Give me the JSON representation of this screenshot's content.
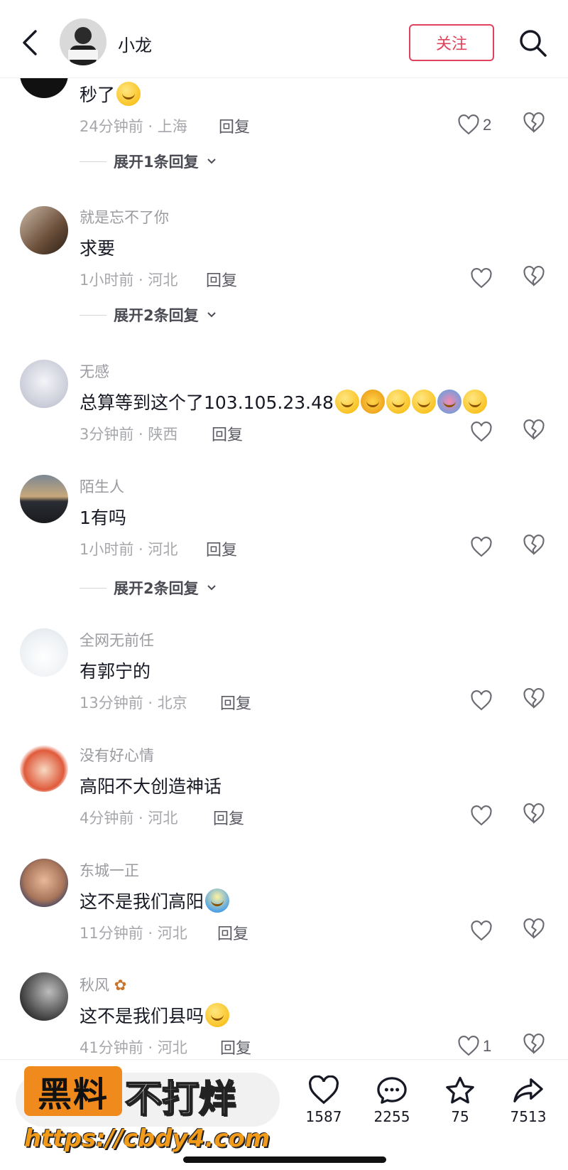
{
  "header": {
    "title": "小龙",
    "follow_label": "关注"
  },
  "comments": [
    {
      "name": "",
      "text": "秒了",
      "time": "24分钟前 · 上海",
      "reply": "回复",
      "likes": "2",
      "expand": "展开1条回复"
    },
    {
      "name": "就是忘不了你",
      "text": "求要",
      "time": "1小时前 · 河北",
      "reply": "回复",
      "likes": "",
      "expand": "展开2条回复"
    },
    {
      "name": "无感",
      "text": "总算等到这个了103.105.23.48",
      "time": "3分钟前 · 陕西",
      "reply": "回复",
      "likes": "",
      "expand": ""
    },
    {
      "name": "陌生人",
      "text": "1有吗",
      "time": "1小时前 · 河北",
      "reply": "回复",
      "likes": "",
      "expand": "展开2条回复"
    },
    {
      "name": "全网无前任",
      "text": "有郭宁的",
      "time": "13分钟前 · 北京",
      "reply": "回复",
      "likes": "",
      "expand": ""
    },
    {
      "name": "没有好心情",
      "text": "高阳不大创造神话",
      "time": "4分钟前 · 河北",
      "reply": "回复",
      "likes": "",
      "expand": ""
    },
    {
      "name": "东城一正",
      "text": "这不是我们高阳",
      "time": "11分钟前 · 河北",
      "reply": "回复",
      "likes": "",
      "expand": ""
    },
    {
      "name": "秋风",
      "text": "这不是我们县吗",
      "time": "41分钟前 · 河北",
      "reply": "回复",
      "likes": "1",
      "expand": ""
    }
  ],
  "bottom_bar": {
    "likes": "1587",
    "comments": "2255",
    "favorites": "75",
    "shares": "7513"
  },
  "watermark": {
    "box": "黑料",
    "side": "不打烊",
    "url": "https://cbdy4.com"
  }
}
